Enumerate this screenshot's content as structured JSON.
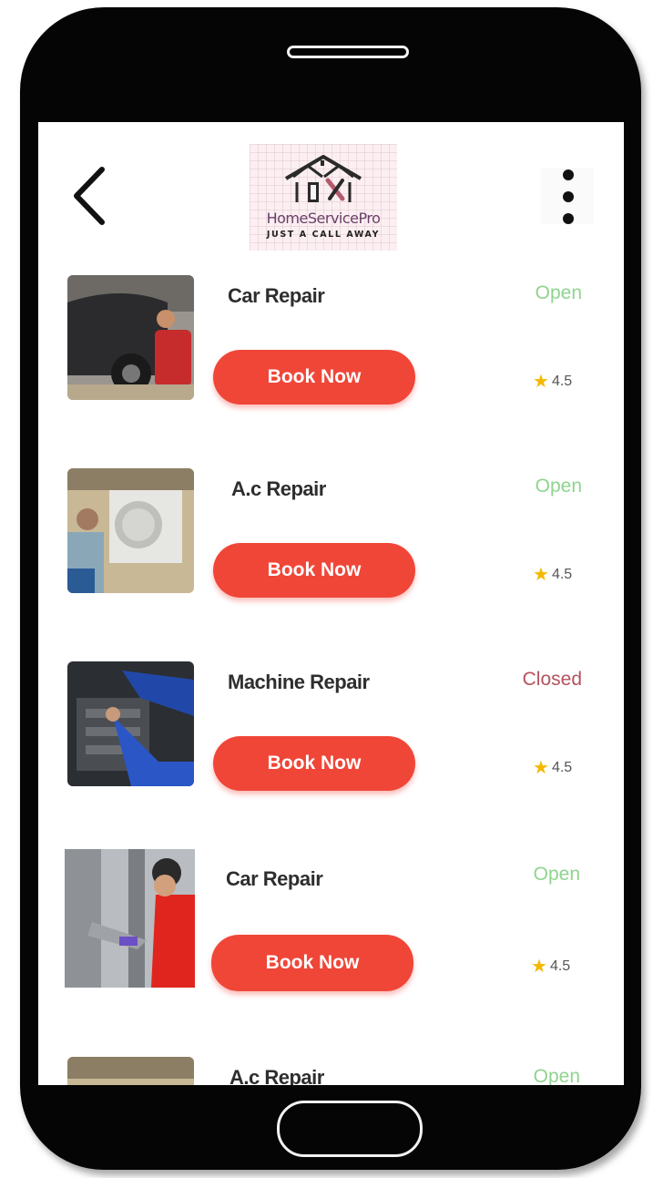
{
  "header": {
    "logo_name": "HomeServicePro",
    "logo_tagline": "JUST A CALL AWAY",
    "back_icon": "chevron-left-icon",
    "menu_icon": "more-vertical-icon"
  },
  "services": [
    {
      "title": "Car Repair",
      "status": "Open",
      "button": "Book Now",
      "rating": "4.5"
    },
    {
      "title": "A.c Repair",
      "status": "Open",
      "button": "Book Now",
      "rating": "4.5"
    },
    {
      "title": "Machine Repair",
      "status": "Closed",
      "button": "Book Now",
      "rating": "4.5"
    },
    {
      "title": "Car Repair",
      "status": "Open",
      "button": "Book Now",
      "rating": "4.5"
    },
    {
      "title": "A.c Repair",
      "status": "Open"
    }
  ],
  "colors": {
    "button": "#f04638",
    "open": "#8fd48f",
    "closed": "#b5525e",
    "star": "#f5b800"
  }
}
